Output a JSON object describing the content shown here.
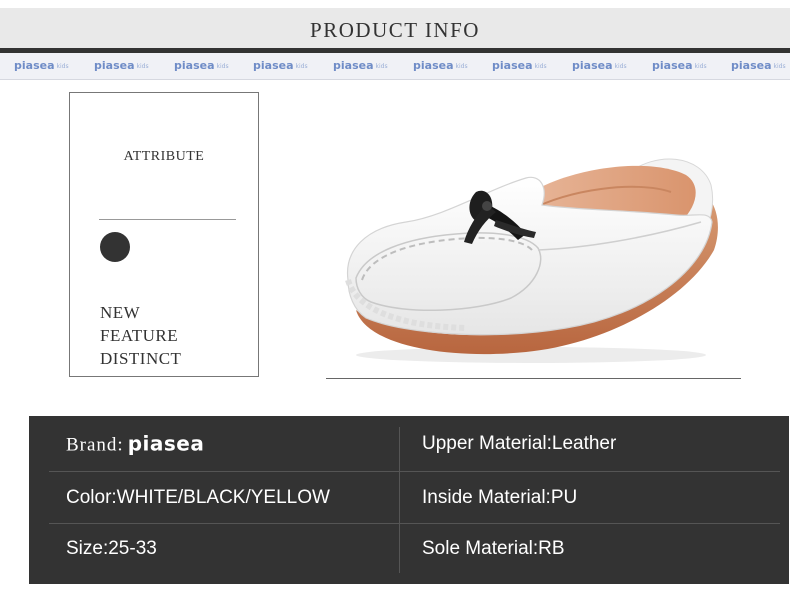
{
  "header": {
    "title": "PRODUCT  INFO"
  },
  "brand_strip": {
    "tiles": [
      {
        "name": "piasea",
        "sub": "kids"
      },
      {
        "name": "piasea",
        "sub": "kids"
      },
      {
        "name": "piasea",
        "sub": "kids"
      },
      {
        "name": "piasea",
        "sub": "kids"
      },
      {
        "name": "piasea",
        "sub": "kids"
      },
      {
        "name": "piasea",
        "sub": "kids"
      },
      {
        "name": "piasea",
        "sub": "kids"
      },
      {
        "name": "piasea",
        "sub": "kids"
      },
      {
        "name": "piasea",
        "sub": "kids"
      },
      {
        "name": "piasea",
        "sub": "kids"
      }
    ]
  },
  "attribute": {
    "title": "ATTRIBUTE",
    "dot_color": "#333333",
    "features": [
      "NEW",
      "FEATURE",
      "DISTINCT"
    ]
  },
  "product_image": {
    "icon": "white-loafer-shoe-icon"
  },
  "specs": {
    "brand_label": "Brand:",
    "brand_logo": "piasea",
    "upper_material": "Upper Material:Leather",
    "color": "Color:WHITE/BLACK/YELLOW",
    "inside_material": "Inside Material:PU",
    "size": "Size:25-33",
    "sole_material": "Sole Material:RB"
  },
  "colors": {
    "spec_background": "#333333",
    "header_background": "#e9e9e9",
    "brand_strip_text": "#6f8cc7"
  }
}
